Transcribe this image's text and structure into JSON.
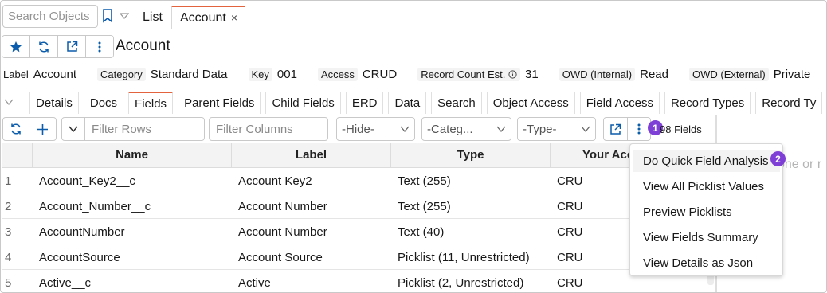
{
  "topbar": {
    "search_placeholder": "Search Objects",
    "tabs": [
      {
        "label": "List"
      },
      {
        "label": "Account",
        "close": "×"
      }
    ]
  },
  "header": {
    "title": "Account"
  },
  "info": [
    {
      "key": "Label",
      "value": "Account"
    },
    {
      "key": "Category",
      "value": "Standard Data"
    },
    {
      "key": "Key",
      "value": "001"
    },
    {
      "key": "Access",
      "value": "CRUD"
    },
    {
      "key": "Record Count Est.",
      "value": "31"
    },
    {
      "key": "OWD (Internal)",
      "value": "Read"
    },
    {
      "key": "OWD (External)",
      "value": "Private"
    }
  ],
  "subtabs": [
    "Details",
    "Docs",
    "Fields",
    "Parent Fields",
    "Child Fields",
    "ERD",
    "Data",
    "Search",
    "Object Access",
    "Field Access",
    "Record Types",
    "Record Ty"
  ],
  "toolbar": {
    "filter_rows_placeholder": "Filter Rows",
    "filter_columns_placeholder": "Filter Columns",
    "select_hide": "-Hide-",
    "select_category": "-Categ...",
    "select_type": "-Type-",
    "field_count": "98 Fields",
    "badge1": "1",
    "badge2": "2"
  },
  "table": {
    "columns": [
      "Name",
      "Label",
      "Type",
      "Your Acc"
    ],
    "rows": [
      {
        "num": "1",
        "name": "Account_Key2__c",
        "label": "Account Key2",
        "type": "Text (255)",
        "access": "CRU"
      },
      {
        "num": "2",
        "name": "Account_Number__c",
        "label": "Account Number",
        "type": "Text (255)",
        "access": "CRU"
      },
      {
        "num": "3",
        "name": "AccountNumber",
        "label": "Account Number",
        "type": "Text (40)",
        "access": "CRU"
      },
      {
        "num": "4",
        "name": "AccountSource",
        "label": "Account Source",
        "type": "Picklist (11, Unrestricted)",
        "access": "CRU"
      },
      {
        "num": "5",
        "name": "Active__c",
        "label": "Active",
        "type": "Picklist (2, Unrestricted)",
        "access": "CRU"
      }
    ]
  },
  "side_ghost_text": "one or r",
  "menu": {
    "items": [
      "Do Quick Field Analysis",
      "View All Picklist Values",
      "Preview Picklists",
      "View Fields Summary",
      "View Details as Json"
    ]
  },
  "colors": {
    "accent_tab": "#e4633f",
    "icon_blue": "#0b5cab",
    "badge": "#7e3fd6"
  }
}
